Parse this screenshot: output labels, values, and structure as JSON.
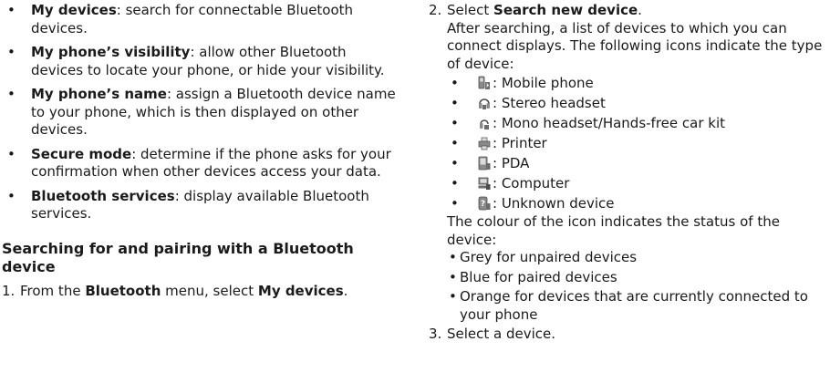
{
  "left": {
    "options": [
      {
        "title": "My devices",
        "desc": ": search for connectable Bluetooth devices."
      },
      {
        "title": "My phone’s visibility",
        "desc": ": allow other Bluetooth devices to locate your phone, or hide your visibility."
      },
      {
        "title": "My phone’s name",
        "desc": ": assign a Bluetooth device name to your phone, which is then displayed on other devices."
      },
      {
        "title": "Secure mode",
        "desc": ": determine if the phone asks for your confirmation when other devices access your data."
      },
      {
        "title": "Bluetooth services",
        "desc": ": display available Bluetooth services."
      }
    ],
    "heading": "Searching for and pairing with a Bluetooth device",
    "step1": {
      "num": "1.",
      "pre": "From the ",
      "menu": "Bluetooth",
      "mid": " menu, select ",
      "item": "My devices",
      "post": "."
    }
  },
  "right": {
    "step2": {
      "num": "2.",
      "pre": "Select ",
      "item": "Search new device",
      "post": "."
    },
    "step2_text": "After searching, a list of devices to which you can connect displays. The following icons indicate the type of device:",
    "device_icons": [
      {
        "icon": "mobile-phone-icon",
        "label": ": Mobile phone"
      },
      {
        "icon": "stereo-headset-icon",
        "label": ": Stereo headset"
      },
      {
        "icon": "mono-headset-icon",
        "label": ": Mono headset/Hands-free car kit"
      },
      {
        "icon": "printer-icon",
        "label": ": Printer"
      },
      {
        "icon": "pda-icon",
        "label": ": PDA"
      },
      {
        "icon": "computer-icon",
        "label": ": Computer"
      },
      {
        "icon": "unknown-device-icon",
        "label": ": Unknown device"
      }
    ],
    "colour_text": "The colour of the icon indicates the status of the device:",
    "status": [
      "Grey for unpaired devices",
      "Blue for paired devices",
      "Orange for devices that are currently connected to your phone"
    ],
    "step3": {
      "num": "3.",
      "text": "Select a device."
    }
  },
  "colors": {
    "text": "#1a1a1a",
    "icon_grey": "#8a8a8a",
    "icon_dark": "#4a4a4a"
  }
}
